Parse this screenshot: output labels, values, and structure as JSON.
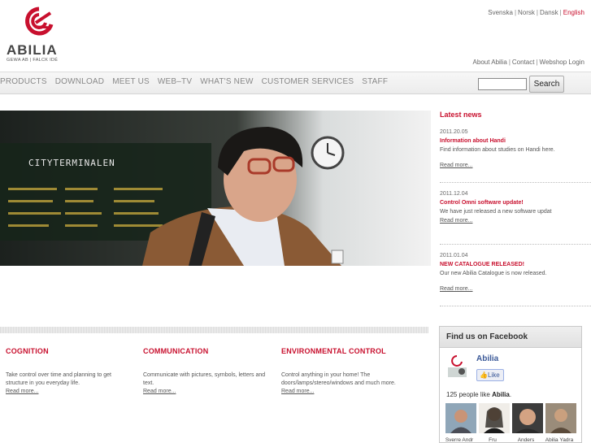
{
  "header": {
    "logo_text": "ABILIA",
    "logo_sub": "GEWA AB | FALCK IDÉ",
    "languages": [
      "Svenska",
      "Norsk",
      "Dansk",
      "English"
    ],
    "util_links": [
      "About Abilia",
      "Contact",
      "Webshop Login"
    ]
  },
  "nav": {
    "items": [
      "PRODUCTS",
      "DOWNLOAD",
      "MEET US",
      "WEB–TV",
      "WHAT'S NEW",
      "CUSTOMER SERVICES",
      "STAFF"
    ],
    "search_label": "Search"
  },
  "hero": {
    "sign_text": "CITYTERMINALEN"
  },
  "news": {
    "title": "Latest news",
    "items": [
      {
        "date": "2011.20.05",
        "head": "Information about Handi",
        "desc": "Find information about studies on Handi here.",
        "more": "Read more..."
      },
      {
        "date": "2011.12.04",
        "head": "Control Omni software update!",
        "desc": "We have just released a new software updat",
        "more": "Read more..."
      },
      {
        "date": "2011.01.04",
        "head": "NEW CATALOGUE RELEASED!",
        "desc": "Our new Abilia Catalogue is now released.",
        "more": "Read more..."
      }
    ]
  },
  "columns": [
    {
      "title": "COGNITION",
      "text": "Take control over time and planning to get structure in you everyday life.",
      "more": "Read more..."
    },
    {
      "title": "COMMUNICATION",
      "text": "Communicate with pictures, symbols, letters and text.",
      "more": "Read more..."
    },
    {
      "title": "ENVIRONMENTAL CONTROL",
      "text": "Control anything in your home! The doors/lamps/stereo/windows and much more.",
      "more": "Read more..."
    }
  ],
  "facebook": {
    "title": "Find us on Facebook",
    "page_name": "Abilia",
    "like_label": "Like",
    "count_text": "125 people like",
    "count_name": "Abilia",
    "count_end": ".",
    "faces": [
      "Sverre Andr",
      "Fru",
      "Anders",
      "Abilia Yadra"
    ]
  },
  "colors": {
    "accent": "#c8102e",
    "facebook": "#3b5998"
  }
}
